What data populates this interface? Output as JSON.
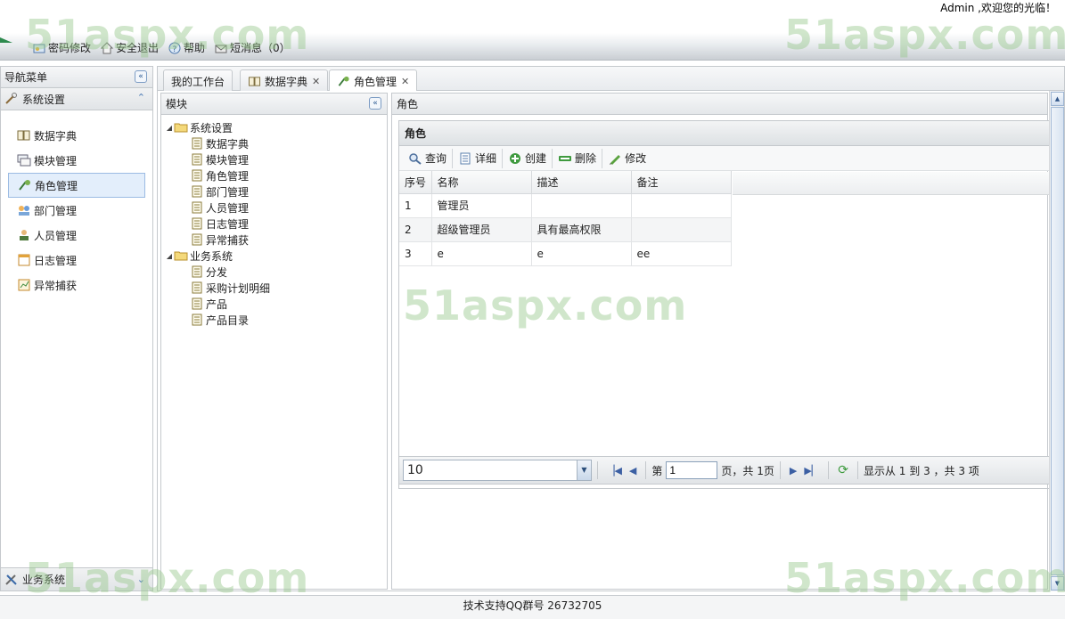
{
  "header": {
    "greeting": "Admin ,欢迎您的光临！",
    "toolbar": [
      {
        "label": "密码修改",
        "icon": "key-icon"
      },
      {
        "label": "安全退出",
        "icon": "home-exit-icon"
      },
      {
        "label": "帮助",
        "icon": "help-icon"
      },
      {
        "label": "短消息（0）",
        "icon": "message-icon"
      }
    ]
  },
  "watermark": "51aspx.com",
  "nav": {
    "title": "导航菜单",
    "section": "系统设置",
    "items": [
      {
        "label": "数据字典",
        "active": false
      },
      {
        "label": "模块管理",
        "active": false
      },
      {
        "label": "角色管理",
        "active": true
      },
      {
        "label": "部门管理",
        "active": false
      },
      {
        "label": "人员管理",
        "active": false
      },
      {
        "label": "日志管理",
        "active": false
      },
      {
        "label": "异常捕获",
        "active": false
      }
    ],
    "bottom_section": "业务系统"
  },
  "tabs": [
    {
      "label": "我的工作台",
      "closable": false
    },
    {
      "label": "数据字典",
      "closable": true
    },
    {
      "label": "角色管理",
      "closable": true,
      "active": true
    }
  ],
  "module_panel": {
    "title": "模块",
    "tree": [
      {
        "label": "系统设置",
        "children": [
          "数据字典",
          "模块管理",
          "角色管理",
          "部门管理",
          "人员管理",
          "日志管理",
          "异常捕获"
        ]
      },
      {
        "label": "业务系统",
        "children": [
          "分发",
          "采购计划明细",
          "产品",
          "产品目录"
        ]
      }
    ]
  },
  "role_panel": {
    "title": "角色",
    "grid_title": "角色",
    "toolbar": {
      "query": "查询",
      "detail": "详细",
      "create": "创建",
      "delete": "删除",
      "edit": "修改"
    },
    "columns": [
      "序号",
      "名称",
      "描述",
      "备注"
    ],
    "rows": [
      [
        "1",
        "管理员",
        "",
        ""
      ],
      [
        "2",
        "超级管理员",
        "具有最高权限",
        ""
      ],
      [
        "3",
        "e",
        "e",
        "ee"
      ]
    ],
    "pager": {
      "page_size": "10",
      "page_prefix": "第",
      "page_value": "1",
      "page_suffix": "页，共 1页",
      "display": "显示从 1 到 3 ，共 3 项"
    }
  },
  "footer": {
    "text": "技术支持QQ群号 26732705"
  }
}
